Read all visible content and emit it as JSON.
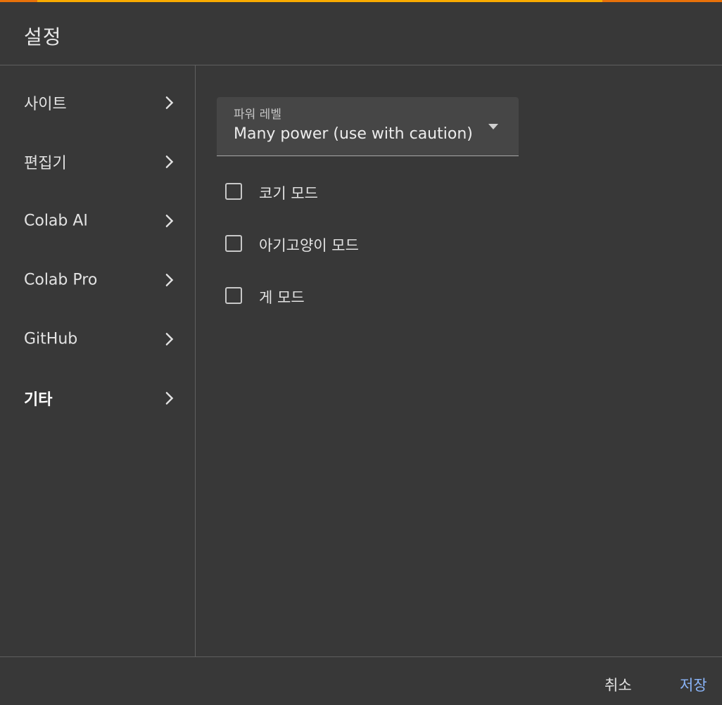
{
  "dialog": {
    "title": "설정",
    "accent_colors": {
      "stripe": "#f9ab00",
      "stripe_edges": "#e8710a",
      "save": "#8ab4f8"
    }
  },
  "sidebar": {
    "items": [
      {
        "label": "사이트",
        "icon": "chevron-right-icon",
        "active": false
      },
      {
        "label": "편집기",
        "icon": "chevron-right-icon",
        "active": false
      },
      {
        "label": "Colab AI",
        "icon": "chevron-right-icon",
        "active": false
      },
      {
        "label": "Colab Pro",
        "icon": "chevron-right-icon",
        "active": false
      },
      {
        "label": "GitHub",
        "icon": "chevron-right-icon",
        "active": false
      },
      {
        "label": "기타",
        "icon": "chevron-right-icon",
        "active": true
      }
    ]
  },
  "main": {
    "power_level": {
      "label": "파워 레벨",
      "value": "Many power (use with caution)",
      "icon": "dropdown-arrow-icon"
    },
    "checkboxes": [
      {
        "label": "코기 모드",
        "checked": false
      },
      {
        "label": "아기고양이 모드",
        "checked": false
      },
      {
        "label": "게 모드",
        "checked": false
      }
    ]
  },
  "footer": {
    "cancel_label": "취소",
    "save_label": "저장"
  }
}
